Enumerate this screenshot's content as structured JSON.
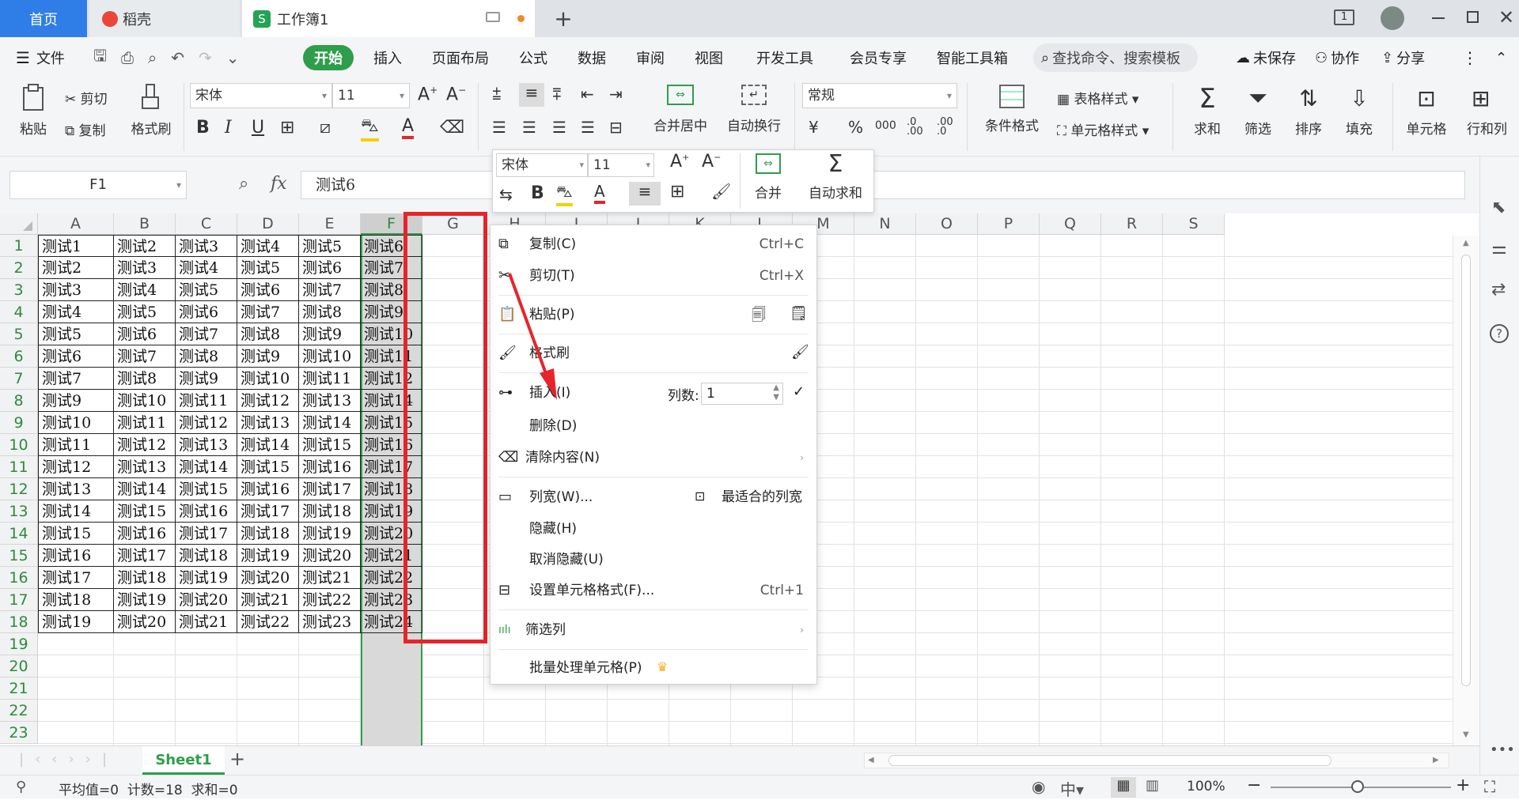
{
  "tabs": [
    {
      "label": "首页"
    },
    {
      "label": "稻壳"
    },
    {
      "label": "工作簿1"
    }
  ],
  "menu": [
    "文件",
    "开始",
    "插入",
    "页面布局",
    "公式",
    "数据",
    "审阅",
    "视图",
    "开发工具",
    "会员专享",
    "智能工具箱"
  ],
  "search_placeholder": "查找命令、搜索模板",
  "menu_right": {
    "unsaved": "未保存",
    "collab": "协作",
    "share": "分享"
  },
  "toolbar": {
    "paste": "粘贴",
    "cut": "剪切",
    "copy": "复制",
    "format_painter": "格式刷",
    "font": "宋体",
    "size": "11",
    "merge_center": "合并居中",
    "wrap": "自动换行",
    "num_format": "常规",
    "cond_format": "条件格式",
    "table_style": "表格样式",
    "cell_style": "单元格样式",
    "sum": "求和",
    "filter": "筛选",
    "sort": "排序",
    "fill": "填充",
    "cells": "单元格",
    "rowcol": "行和列"
  },
  "formula_bar": {
    "name_box": "F1",
    "fx": "fx",
    "value": "测试6"
  },
  "columns": [
    "A",
    "B",
    "C",
    "D",
    "E",
    "F",
    "G",
    "H",
    "I",
    "J",
    "K",
    "L",
    "M",
    "N",
    "O",
    "P",
    "Q",
    "R",
    "S"
  ],
  "rows": [
    "1",
    "2",
    "3",
    "4",
    "5",
    "6",
    "7",
    "8",
    "9",
    "10",
    "11",
    "12",
    "13",
    "14",
    "15",
    "16",
    "17",
    "18",
    "19",
    "20",
    "21",
    "22",
    "23"
  ],
  "cells": [
    [
      "测试1",
      "测试2",
      "测试3",
      "测试4",
      "测试5",
      "测试6"
    ],
    [
      "测试2",
      "测试3",
      "测试4",
      "测试5",
      "测试6",
      "测试7"
    ],
    [
      "测试3",
      "测试4",
      "测试5",
      "测试6",
      "测试7",
      "测试8"
    ],
    [
      "测试4",
      "测试5",
      "测试6",
      "测试7",
      "测试8",
      "测试9"
    ],
    [
      "测试5",
      "测试6",
      "测试7",
      "测试8",
      "测试9",
      "测试10"
    ],
    [
      "测试6",
      "测试7",
      "测试8",
      "测试9",
      "测试10",
      "测试11"
    ],
    [
      "测试7",
      "测试8",
      "测试9",
      "测试10",
      "测试11",
      "测试12"
    ],
    [
      "测试9",
      "测试10",
      "测试11",
      "测试12",
      "测试13",
      "测试14"
    ],
    [
      "测试10",
      "测试11",
      "测试12",
      "测试13",
      "测试14",
      "测试15"
    ],
    [
      "测试11",
      "测试12",
      "测试13",
      "测试14",
      "测试15",
      "测试16"
    ],
    [
      "测试12",
      "测试13",
      "测试14",
      "测试15",
      "测试16",
      "测试17"
    ],
    [
      "测试13",
      "测试14",
      "测试15",
      "测试16",
      "测试17",
      "测试18"
    ],
    [
      "测试14",
      "测试15",
      "测试16",
      "测试17",
      "测试18",
      "测试19"
    ],
    [
      "测试15",
      "测试16",
      "测试17",
      "测试18",
      "测试19",
      "测试20"
    ],
    [
      "测试16",
      "测试17",
      "测试18",
      "测试19",
      "测试20",
      "测试21"
    ],
    [
      "测试17",
      "测试18",
      "测试19",
      "测试20",
      "测试21",
      "测试22"
    ],
    [
      "测试18",
      "测试19",
      "测试20",
      "测试21",
      "测试22",
      "测试23"
    ],
    [
      "测试19",
      "测试20",
      "测试21",
      "测试22",
      "测试23",
      "测试24"
    ]
  ],
  "mini_toolbar": {
    "font": "宋体",
    "size": "11",
    "merge": "合并",
    "autosum": "自动求和"
  },
  "context_menu": {
    "copy": "复制(C)",
    "copy_sc": "Ctrl+C",
    "cut": "剪切(T)",
    "cut_sc": "Ctrl+X",
    "paste": "粘贴(P)",
    "format_painter": "格式刷",
    "insert": "插入(I)",
    "col_count_label": "列数:",
    "col_count": "1",
    "delete": "删除(D)",
    "clear": "清除内容(N)",
    "col_width": "列宽(W)...",
    "best_fit": "最适合的列宽",
    "hide": "隐藏(H)",
    "unhide": "取消隐藏(U)",
    "format_cells": "设置单元格格式(F)...",
    "format_cells_sc": "Ctrl+1",
    "filter_col": "筛选列",
    "batch": "批量处理单元格(P)"
  },
  "sheet_tab": "Sheet1",
  "status": {
    "summary": "平均值=0  计数=18  求和=0",
    "zoom": "100%"
  },
  "colors": {
    "accent": "#2e9e4a",
    "highlight": "#e5252a",
    "selection": "#d9d9d9"
  }
}
